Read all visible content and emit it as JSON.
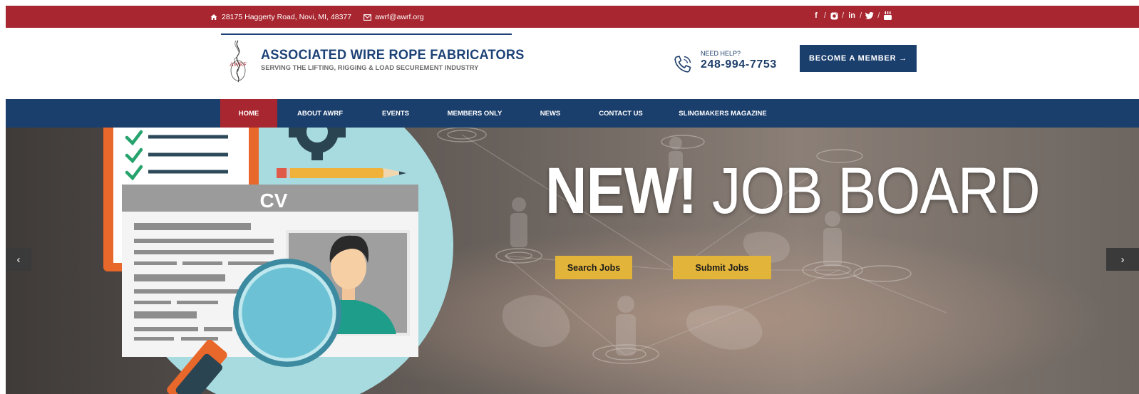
{
  "topbar": {
    "address": "28175 Haggerty Road, Novi, MI, 48377",
    "email": "awrf@awrf.org",
    "social": [
      "facebook-icon",
      "instagram-icon",
      "linkedin-icon",
      "twitter-icon",
      "youtube-icon"
    ],
    "social_glyphs": {
      "facebook": "f",
      "linkedin": "in"
    }
  },
  "header": {
    "logo_mark_text": "AWRF",
    "title": "ASSOCIATED WIRE ROPE FABRICATORS",
    "subtitle": "SERVING THE LIFTING, RIGGING & LOAD SECUREMENT INDUSTRY",
    "help_label": "NEED HELP?",
    "help_phone": "248-994-7753",
    "member_button": "BECOME A MEMBER →"
  },
  "nav": {
    "items": [
      {
        "label": "HOME",
        "active": true
      },
      {
        "label": "ABOUT AWRF",
        "active": false
      },
      {
        "label": "EVENTS",
        "active": false
      },
      {
        "label": "MEMBERS ONLY",
        "active": false
      },
      {
        "label": "NEWS",
        "active": false
      },
      {
        "label": "CONTACT US",
        "active": false
      },
      {
        "label": "SLINGMAKERS MAGAZINE",
        "active": false
      }
    ]
  },
  "hero": {
    "title_strong": "NEW!",
    "title_rest": " JOB BOARD",
    "cv_label": "CV",
    "search_button": "Search Jobs",
    "submit_button": "Submit Jobs",
    "prev_arrow": "‹",
    "next_arrow": "›"
  },
  "colors": {
    "brand_red": "#a8262f",
    "brand_navy": "#1b3f6d",
    "button_gold": "#e2b43a"
  }
}
